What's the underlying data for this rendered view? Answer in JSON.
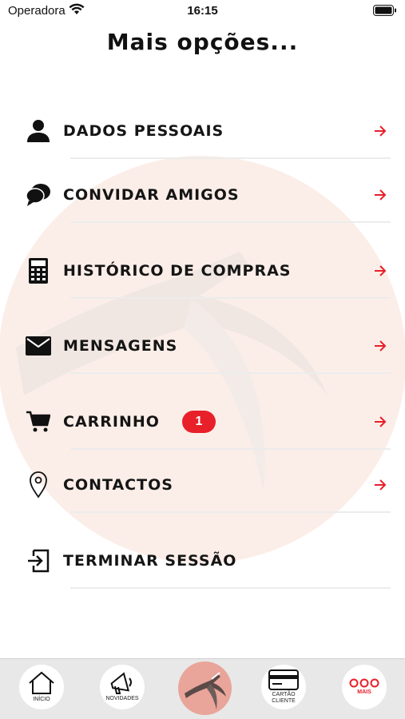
{
  "status_bar": {
    "carrier": "Operadora",
    "time": "16:15"
  },
  "page": {
    "title": "Mais opções..."
  },
  "menu": [
    {
      "label": "DADOS PESSOAIS",
      "icon": "person-icon"
    },
    {
      "label": "CONVIDAR AMIGOS",
      "icon": "chat-bubbles-icon"
    },
    {
      "label": "HISTÓRICO DE COMPRAS",
      "icon": "calculator-icon"
    },
    {
      "label": "MENSAGENS",
      "icon": "envelope-icon"
    },
    {
      "label": "CARRINHO",
      "icon": "cart-icon",
      "badge": "1"
    },
    {
      "label": "CONTACTOS",
      "icon": "location-pin-icon"
    },
    {
      "label": "TERMINAR SESSÃO",
      "icon": "logout-icon"
    }
  ],
  "tab_bar": {
    "tabs": [
      {
        "label": "INÍCIO",
        "icon": "home-icon"
      },
      {
        "label": "NOVIDADES",
        "icon": "megaphone-icon"
      },
      {
        "label": "",
        "icon": "logo-icon"
      },
      {
        "label": "CARTÃO CLIENTE",
        "icon": "card-icon"
      },
      {
        "label": "MAIS",
        "icon": "more-dots-icon"
      }
    ],
    "active_tab": "MAIS"
  },
  "colors": {
    "accent": "#e8202a",
    "tab_bar_bg": "#e8e8e8",
    "logo_bg": "#e9a59a"
  }
}
